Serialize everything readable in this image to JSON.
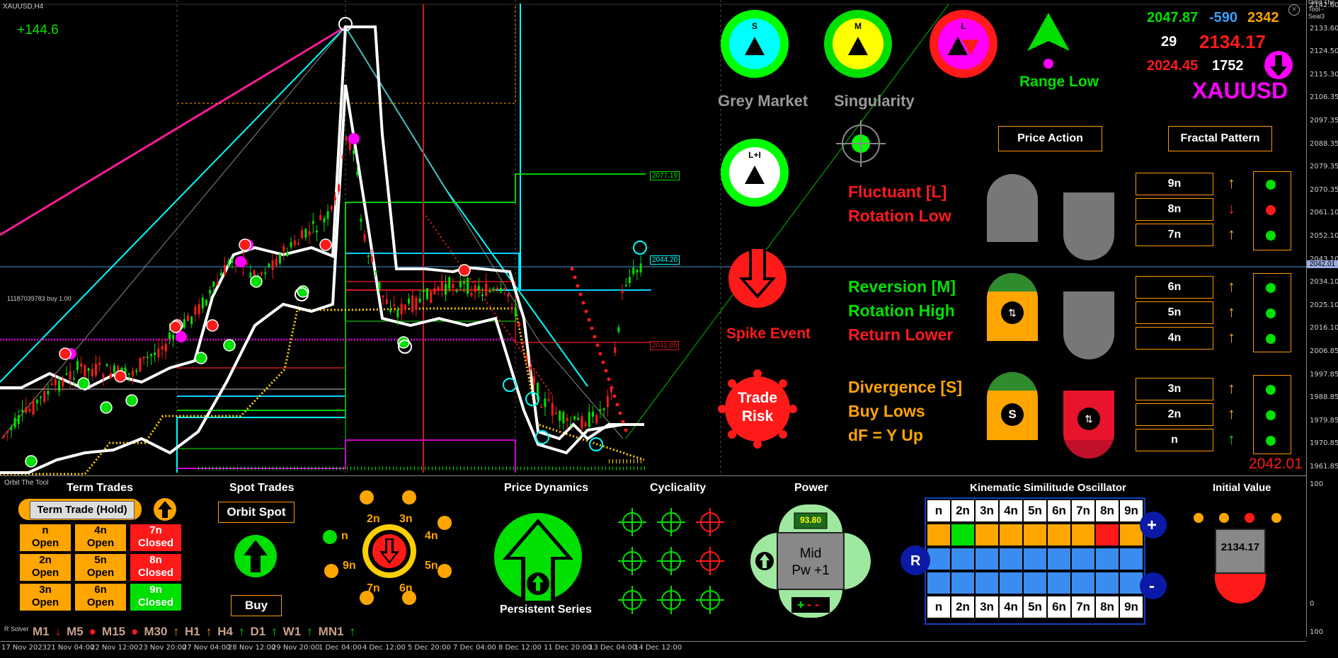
{
  "symbol": "XAUUSD,H4",
  "tool_title": "Orbit The Tool - Seal3",
  "pnl": "+144.6",
  "order_label": "11187039783 buy 1.00",
  "level_labels": [
    "2077.19",
    "2044.20",
    "2011.95"
  ],
  "current_price": "2042.01",
  "price_axis": [
    "2142.60",
    "2133.60",
    "2124.50",
    "2115.30",
    "2106.35",
    "2097.35",
    "2088.35",
    "2079.35",
    "2070.35",
    "2061.10",
    "2052.10",
    "2043.10",
    "2034.10",
    "2025.10",
    "2016.10",
    "2006.85",
    "1997.85",
    "1988.85",
    "1979.85",
    "1970.85",
    "1961.85"
  ],
  "indicator_axis": [
    "100",
    "0",
    "100"
  ],
  "date_axis": [
    "17 Nov 2023",
    "21 Nov 04:00",
    "22 Nov 12:00",
    "23 Nov 20:00",
    "27 Nov 04:00",
    "28 Nov 12:00",
    "29 Nov 20:00",
    "1 Dec 04:00",
    "4 Dec 12:00",
    "5 Dec 20:00",
    "7 Dec 04:00",
    "8 Dec 12:00",
    "11 Dec 20:00",
    "13 Dec 04:00",
    "14 Dec 12:00"
  ],
  "modes": {
    "s": "S",
    "m": "M",
    "l": "L",
    "li": "L+I",
    "grey": "Grey Market",
    "sing": "Singularity"
  },
  "range_low": "Range Low",
  "stats": {
    "a": "2047.87",
    "b": "-590",
    "c": "2342",
    "d": "29",
    "e": "2134.17",
    "f": "2024.45",
    "g": "1752"
  },
  "symbol_big": "XAUUSD",
  "buttons": {
    "price_action": "Price Action",
    "fractal": "Fractal Pattern"
  },
  "states": {
    "fluct": "Fluctuant [L]",
    "rot_low": "Rotation Low",
    "reversion": "Reversion [M]",
    "rot_high": "Rotation High",
    "return_lower": "Return Lower",
    "divergence": "Divergence [S]",
    "buy_lows": "Buy Lows",
    "df": "dF = Y Up"
  },
  "spike": "Spike Event",
  "trade_risk": [
    "Trade",
    "Risk"
  ],
  "price_box": "2042.01",
  "fractals": [
    "9n",
    "8n",
    "7n",
    "6n",
    "5n",
    "4n",
    "3n",
    "2n",
    "n"
  ],
  "panel": {
    "label": "Orbit The Tool",
    "term_trades": "Term Trades",
    "term_hold": "Term Trade (Hold)",
    "cells": [
      [
        "n",
        "Open"
      ],
      [
        "4n",
        "Open"
      ],
      [
        "7n",
        "Closed"
      ],
      [
        "2n",
        "Open"
      ],
      [
        "5n",
        "Open"
      ],
      [
        "8n",
        "Closed"
      ],
      [
        "3n",
        "Open"
      ],
      [
        "6n",
        "Open"
      ],
      [
        "9n",
        "Closed"
      ]
    ],
    "spot_trades": "Spot Trades",
    "orbit_spot": "Orbit Spot",
    "buy": "Buy",
    "dial": [
      "n",
      "2n",
      "3n",
      "4n",
      "5n",
      "6n",
      "7n",
      "9n"
    ],
    "price_dynamics": "Price Dynamics",
    "persistent": "Persistent Series",
    "cyclicality": "Cyclicality",
    "power": "Power",
    "power_val": "93.80",
    "mid": [
      "Mid",
      "Pw +1"
    ],
    "kso": "Kinematic Similitude Oscillator",
    "kso_cols": [
      "n",
      "2n",
      "3n",
      "4n",
      "5n",
      "6n",
      "7n",
      "8n",
      "9n"
    ],
    "initial_value": "Initial Value",
    "init_val": "2134.17"
  },
  "solver": "R Solver",
  "timeframes": [
    "M1",
    "M5",
    "M15",
    "M30",
    "H1",
    "H4",
    "D1",
    "W1",
    "MN1"
  ],
  "colors": {
    "green": "#00e000",
    "orange": "#ffa500",
    "red": "#ff1a1a",
    "cyan": "#00ffff",
    "magenta": "#ff00ff",
    "yellow": "#ffff00"
  }
}
